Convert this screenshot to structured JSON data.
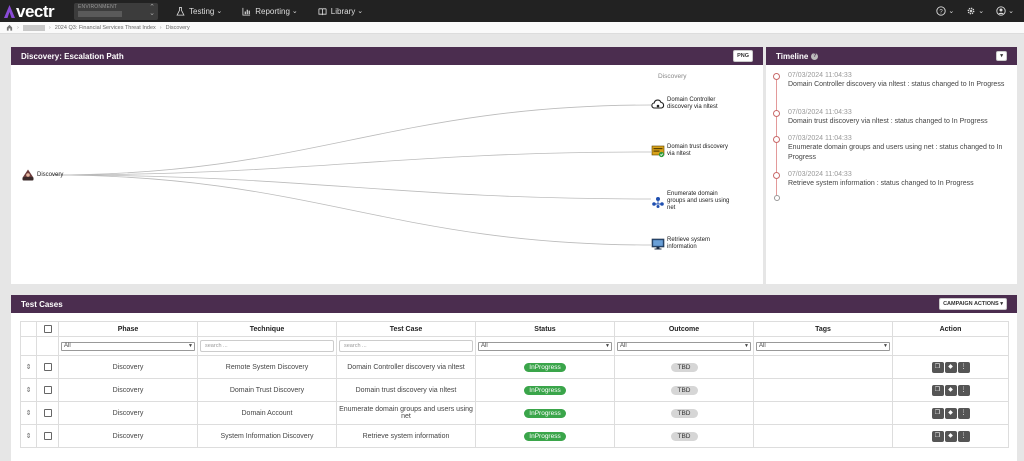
{
  "app": {
    "name": "vectr"
  },
  "environment": {
    "label": "ENVIRONMENT"
  },
  "nav": [
    {
      "label": "Testing",
      "icon": "flask-icon"
    },
    {
      "label": "Reporting",
      "icon": "chart-icon"
    },
    {
      "label": "Library",
      "icon": "book-icon"
    }
  ],
  "breadcrumb": [
    "2024 Q3: Financial Services Threat Index",
    "Discovery"
  ],
  "graph_panel": {
    "title": "Discovery: Escalation Path",
    "png_button": "PNG",
    "column_title": "Discovery",
    "root": {
      "label": "Discovery"
    },
    "nodes": [
      {
        "label": "Domain Controller discovery via nltest",
        "icon": "cloud-icon"
      },
      {
        "label": "Domain trust discovery via nltest",
        "icon": "server-check-icon"
      },
      {
        "label": "Enumerate domain groups and users using net",
        "icon": "users-network-icon"
      },
      {
        "label": "Retrieve system information",
        "icon": "monitor-icon"
      }
    ]
  },
  "timeline": {
    "title": "Timeline",
    "entries": [
      {
        "time": "07/03/2024 11:04:33",
        "text": "Domain Controller discovery via nltest : status changed to In Progress"
      },
      {
        "time": "07/03/2024 11:04:33",
        "text": "Domain trust discovery via nltest : status changed to In Progress"
      },
      {
        "time": "07/03/2024 11:04:33",
        "text": "Enumerate domain groups and users using net : status changed to In Progress"
      },
      {
        "time": "07/03/2024 11:04:33",
        "text": "Retrieve system information : status changed to In Progress"
      }
    ]
  },
  "test_cases": {
    "title": "Test Cases",
    "campaign_button": "CAMPAIGN ACTIONS",
    "columns": [
      "Phase",
      "Technique",
      "Test Case",
      "Status",
      "Outcome",
      "Tags",
      "Action"
    ],
    "filters": {
      "phase": "All",
      "technique_placeholder": "search ...",
      "testcase_placeholder": "search ...",
      "status": "All",
      "outcome": "All",
      "tags": "All"
    },
    "rows": [
      {
        "phase": "Discovery",
        "technique": "Remote System Discovery",
        "test_case": "Domain Controller discovery via nltest",
        "status": "InProgress",
        "outcome": "TBD",
        "tags": ""
      },
      {
        "phase": "Discovery",
        "technique": "Domain Trust Discovery",
        "test_case": "Domain trust discovery via nltest",
        "status": "InProgress",
        "outcome": "TBD",
        "tags": ""
      },
      {
        "phase": "Discovery",
        "technique": "Domain Account",
        "test_case": "Enumerate domain groups and users using net",
        "status": "InProgress",
        "outcome": "TBD",
        "tags": ""
      },
      {
        "phase": "Discovery",
        "technique": "System Information Discovery",
        "test_case": "Retrieve system information",
        "status": "InProgress",
        "outcome": "TBD",
        "tags": ""
      }
    ]
  },
  "colors": {
    "header": "#4b2d4f",
    "nav": "#222222",
    "in_progress": "#3aa54a",
    "timeline_accent": "#c96a6a"
  }
}
